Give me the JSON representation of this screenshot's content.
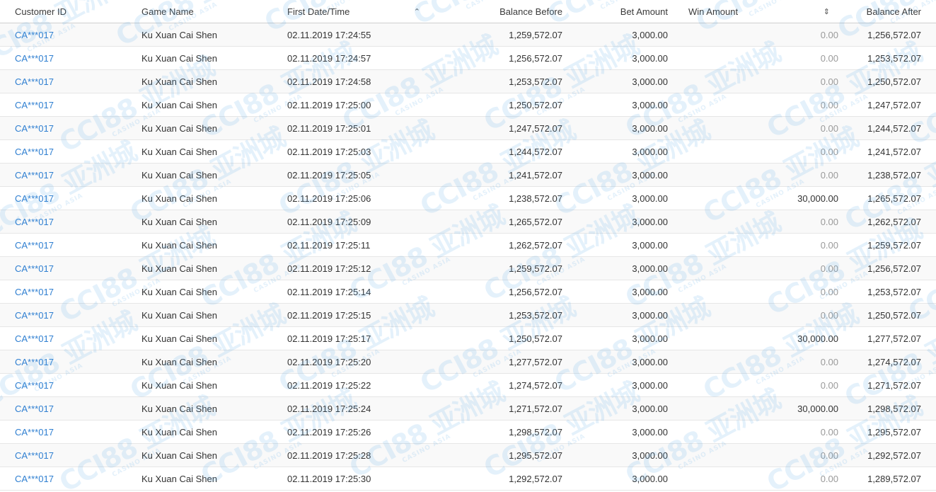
{
  "table": {
    "headers": {
      "customer_id": "Customer ID",
      "game_name": "Game Name",
      "first_datetime": "First Date/Time",
      "balance_before": "Balance Before",
      "bet_amount": "Bet Amount",
      "win_amount": "Win Amount",
      "balance_after": "Balance After"
    },
    "sort_icons": {
      "first_datetime": "sort-ascending-icon",
      "win_amount": "sort-unsorted-icon"
    },
    "rows": [
      {
        "customer_id": "CA***017",
        "game_name": "Ku Xuan Cai Shen",
        "first_datetime": "02.11.2019 17:24:55",
        "balance_before": "1,259,572.07",
        "bet_amount": "3,000.00",
        "win_amount": "0.00",
        "balance_after": "1,256,572.07"
      },
      {
        "customer_id": "CA***017",
        "game_name": "Ku Xuan Cai Shen",
        "first_datetime": "02.11.2019 17:24:57",
        "balance_before": "1,256,572.07",
        "bet_amount": "3,000.00",
        "win_amount": "0.00",
        "balance_after": "1,253,572.07"
      },
      {
        "customer_id": "CA***017",
        "game_name": "Ku Xuan Cai Shen",
        "first_datetime": "02.11.2019 17:24:58",
        "balance_before": "1,253,572.07",
        "bet_amount": "3,000.00",
        "win_amount": "0.00",
        "balance_after": "1,250,572.07"
      },
      {
        "customer_id": "CA***017",
        "game_name": "Ku Xuan Cai Shen",
        "first_datetime": "02.11.2019 17:25:00",
        "balance_before": "1,250,572.07",
        "bet_amount": "3,000.00",
        "win_amount": "0.00",
        "balance_after": "1,247,572.07"
      },
      {
        "customer_id": "CA***017",
        "game_name": "Ku Xuan Cai Shen",
        "first_datetime": "02.11.2019 17:25:01",
        "balance_before": "1,247,572.07",
        "bet_amount": "3,000.00",
        "win_amount": "0.00",
        "balance_after": "1,244,572.07"
      },
      {
        "customer_id": "CA***017",
        "game_name": "Ku Xuan Cai Shen",
        "first_datetime": "02.11.2019 17:25:03",
        "balance_before": "1,244,572.07",
        "bet_amount": "3,000.00",
        "win_amount": "0.00",
        "balance_after": "1,241,572.07"
      },
      {
        "customer_id": "CA***017",
        "game_name": "Ku Xuan Cai Shen",
        "first_datetime": "02.11.2019 17:25:05",
        "balance_before": "1,241,572.07",
        "bet_amount": "3,000.00",
        "win_amount": "0.00",
        "balance_after": "1,238,572.07"
      },
      {
        "customer_id": "CA***017",
        "game_name": "Ku Xuan Cai Shen",
        "first_datetime": "02.11.2019 17:25:06",
        "balance_before": "1,238,572.07",
        "bet_amount": "3,000.00",
        "win_amount": "30,000.00",
        "balance_after": "1,265,572.07"
      },
      {
        "customer_id": "CA***017",
        "game_name": "Ku Xuan Cai Shen",
        "first_datetime": "02.11.2019 17:25:09",
        "balance_before": "1,265,572.07",
        "bet_amount": "3,000.00",
        "win_amount": "0.00",
        "balance_after": "1,262,572.07"
      },
      {
        "customer_id": "CA***017",
        "game_name": "Ku Xuan Cai Shen",
        "first_datetime": "02.11.2019 17:25:11",
        "balance_before": "1,262,572.07",
        "bet_amount": "3,000.00",
        "win_amount": "0.00",
        "balance_after": "1,259,572.07"
      },
      {
        "customer_id": "CA***017",
        "game_name": "Ku Xuan Cai Shen",
        "first_datetime": "02.11.2019 17:25:12",
        "balance_before": "1,259,572.07",
        "bet_amount": "3,000.00",
        "win_amount": "0.00",
        "balance_after": "1,256,572.07"
      },
      {
        "customer_id": "CA***017",
        "game_name": "Ku Xuan Cai Shen",
        "first_datetime": "02.11.2019 17:25:14",
        "balance_before": "1,256,572.07",
        "bet_amount": "3,000.00",
        "win_amount": "0.00",
        "balance_after": "1,253,572.07"
      },
      {
        "customer_id": "CA***017",
        "game_name": "Ku Xuan Cai Shen",
        "first_datetime": "02.11.2019 17:25:15",
        "balance_before": "1,253,572.07",
        "bet_amount": "3,000.00",
        "win_amount": "0.00",
        "balance_after": "1,250,572.07"
      },
      {
        "customer_id": "CA***017",
        "game_name": "Ku Xuan Cai Shen",
        "first_datetime": "02.11.2019 17:25:17",
        "balance_before": "1,250,572.07",
        "bet_amount": "3,000.00",
        "win_amount": "30,000.00",
        "balance_after": "1,277,572.07"
      },
      {
        "customer_id": "CA***017",
        "game_name": "Ku Xuan Cai Shen",
        "first_datetime": "02.11.2019 17:25:20",
        "balance_before": "1,277,572.07",
        "bet_amount": "3,000.00",
        "win_amount": "0.00",
        "balance_after": "1,274,572.07"
      },
      {
        "customer_id": "CA***017",
        "game_name": "Ku Xuan Cai Shen",
        "first_datetime": "02.11.2019 17:25:22",
        "balance_before": "1,274,572.07",
        "bet_amount": "3,000.00",
        "win_amount": "0.00",
        "balance_after": "1,271,572.07"
      },
      {
        "customer_id": "CA***017",
        "game_name": "Ku Xuan Cai Shen",
        "first_datetime": "02.11.2019 17:25:24",
        "balance_before": "1,271,572.07",
        "bet_amount": "3,000.00",
        "win_amount": "30,000.00",
        "balance_after": "1,298,572.07"
      },
      {
        "customer_id": "CA***017",
        "game_name": "Ku Xuan Cai Shen",
        "first_datetime": "02.11.2019 17:25:26",
        "balance_before": "1,298,572.07",
        "bet_amount": "3,000.00",
        "win_amount": "0.00",
        "balance_after": "1,295,572.07"
      },
      {
        "customer_id": "CA***017",
        "game_name": "Ku Xuan Cai Shen",
        "first_datetime": "02.11.2019 17:25:28",
        "balance_before": "1,295,572.07",
        "bet_amount": "3,000.00",
        "win_amount": "0.00",
        "balance_after": "1,292,572.07"
      },
      {
        "customer_id": "CA***017",
        "game_name": "Ku Xuan Cai Shen",
        "first_datetime": "02.11.2019 17:25:30",
        "balance_before": "1,292,572.07",
        "bet_amount": "3,000.00",
        "win_amount": "0.00",
        "balance_after": "1,289,572.07"
      }
    ]
  },
  "watermark": {
    "logo": "CCI88 亚洲城",
    "tagline": "CASINO ASIA",
    "color": "#5aaae6"
  },
  "colors": {
    "link": "#2f7fd1",
    "muted": "#9a9a9a",
    "text": "#333333"
  }
}
